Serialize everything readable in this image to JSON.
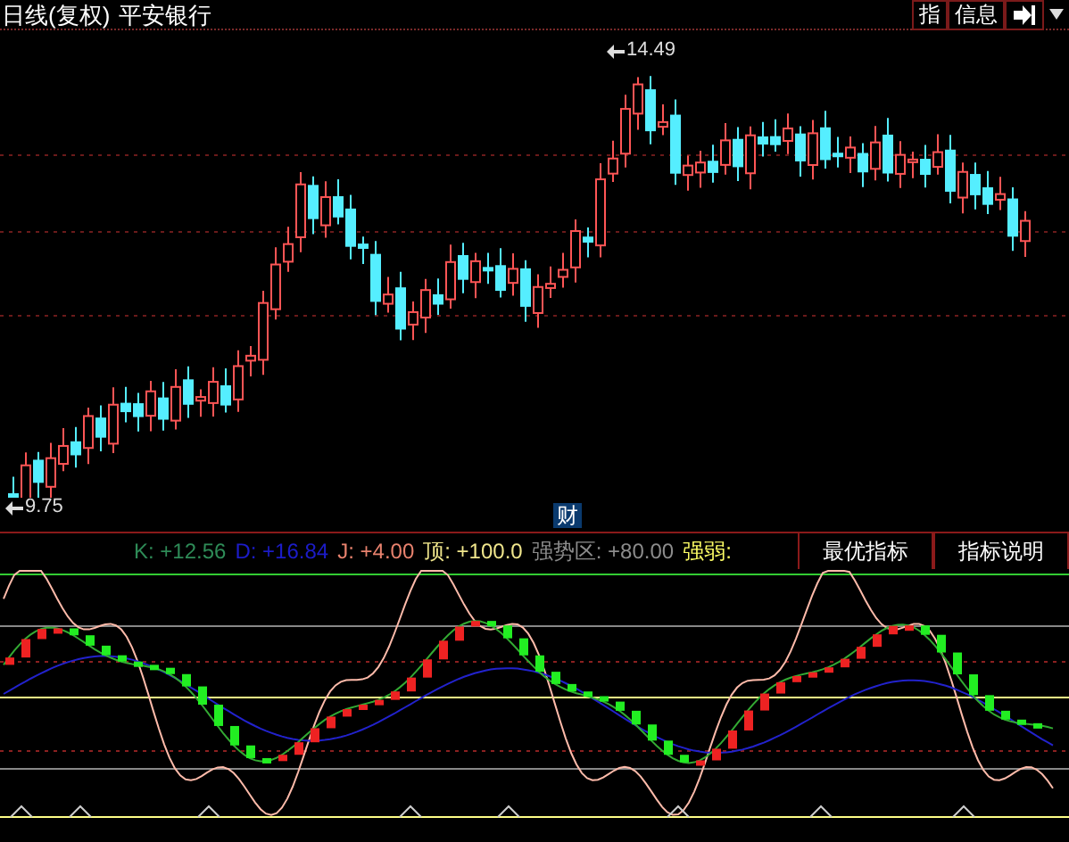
{
  "window": {
    "title": "日线(复权)",
    "stock_name": "平安银行"
  },
  "toolbar": [
    {
      "label": "指"
    },
    {
      "label": "信息"
    }
  ],
  "price_chart": {
    "high_label": "14.49",
    "low_label": "9.75"
  },
  "finance_button": "财",
  "indicator": {
    "values": [
      {
        "text": "K: +12.56",
        "color": "#2e8b57"
      },
      {
        "text": "D: +16.84",
        "color": "#1c1cc8"
      },
      {
        "text": "J: +4.00",
        "color": "#e8826e"
      },
      {
        "text": "顶: +100.0",
        "color": "#f0e68c"
      },
      {
        "text": "强势区: +80.00",
        "color": "#8c8c8c"
      },
      {
        "text": "强弱:",
        "color": "#ffff66"
      }
    ]
  },
  "tabs": [
    {
      "label": "最优指标"
    },
    {
      "label": "指标说明"
    }
  ]
}
